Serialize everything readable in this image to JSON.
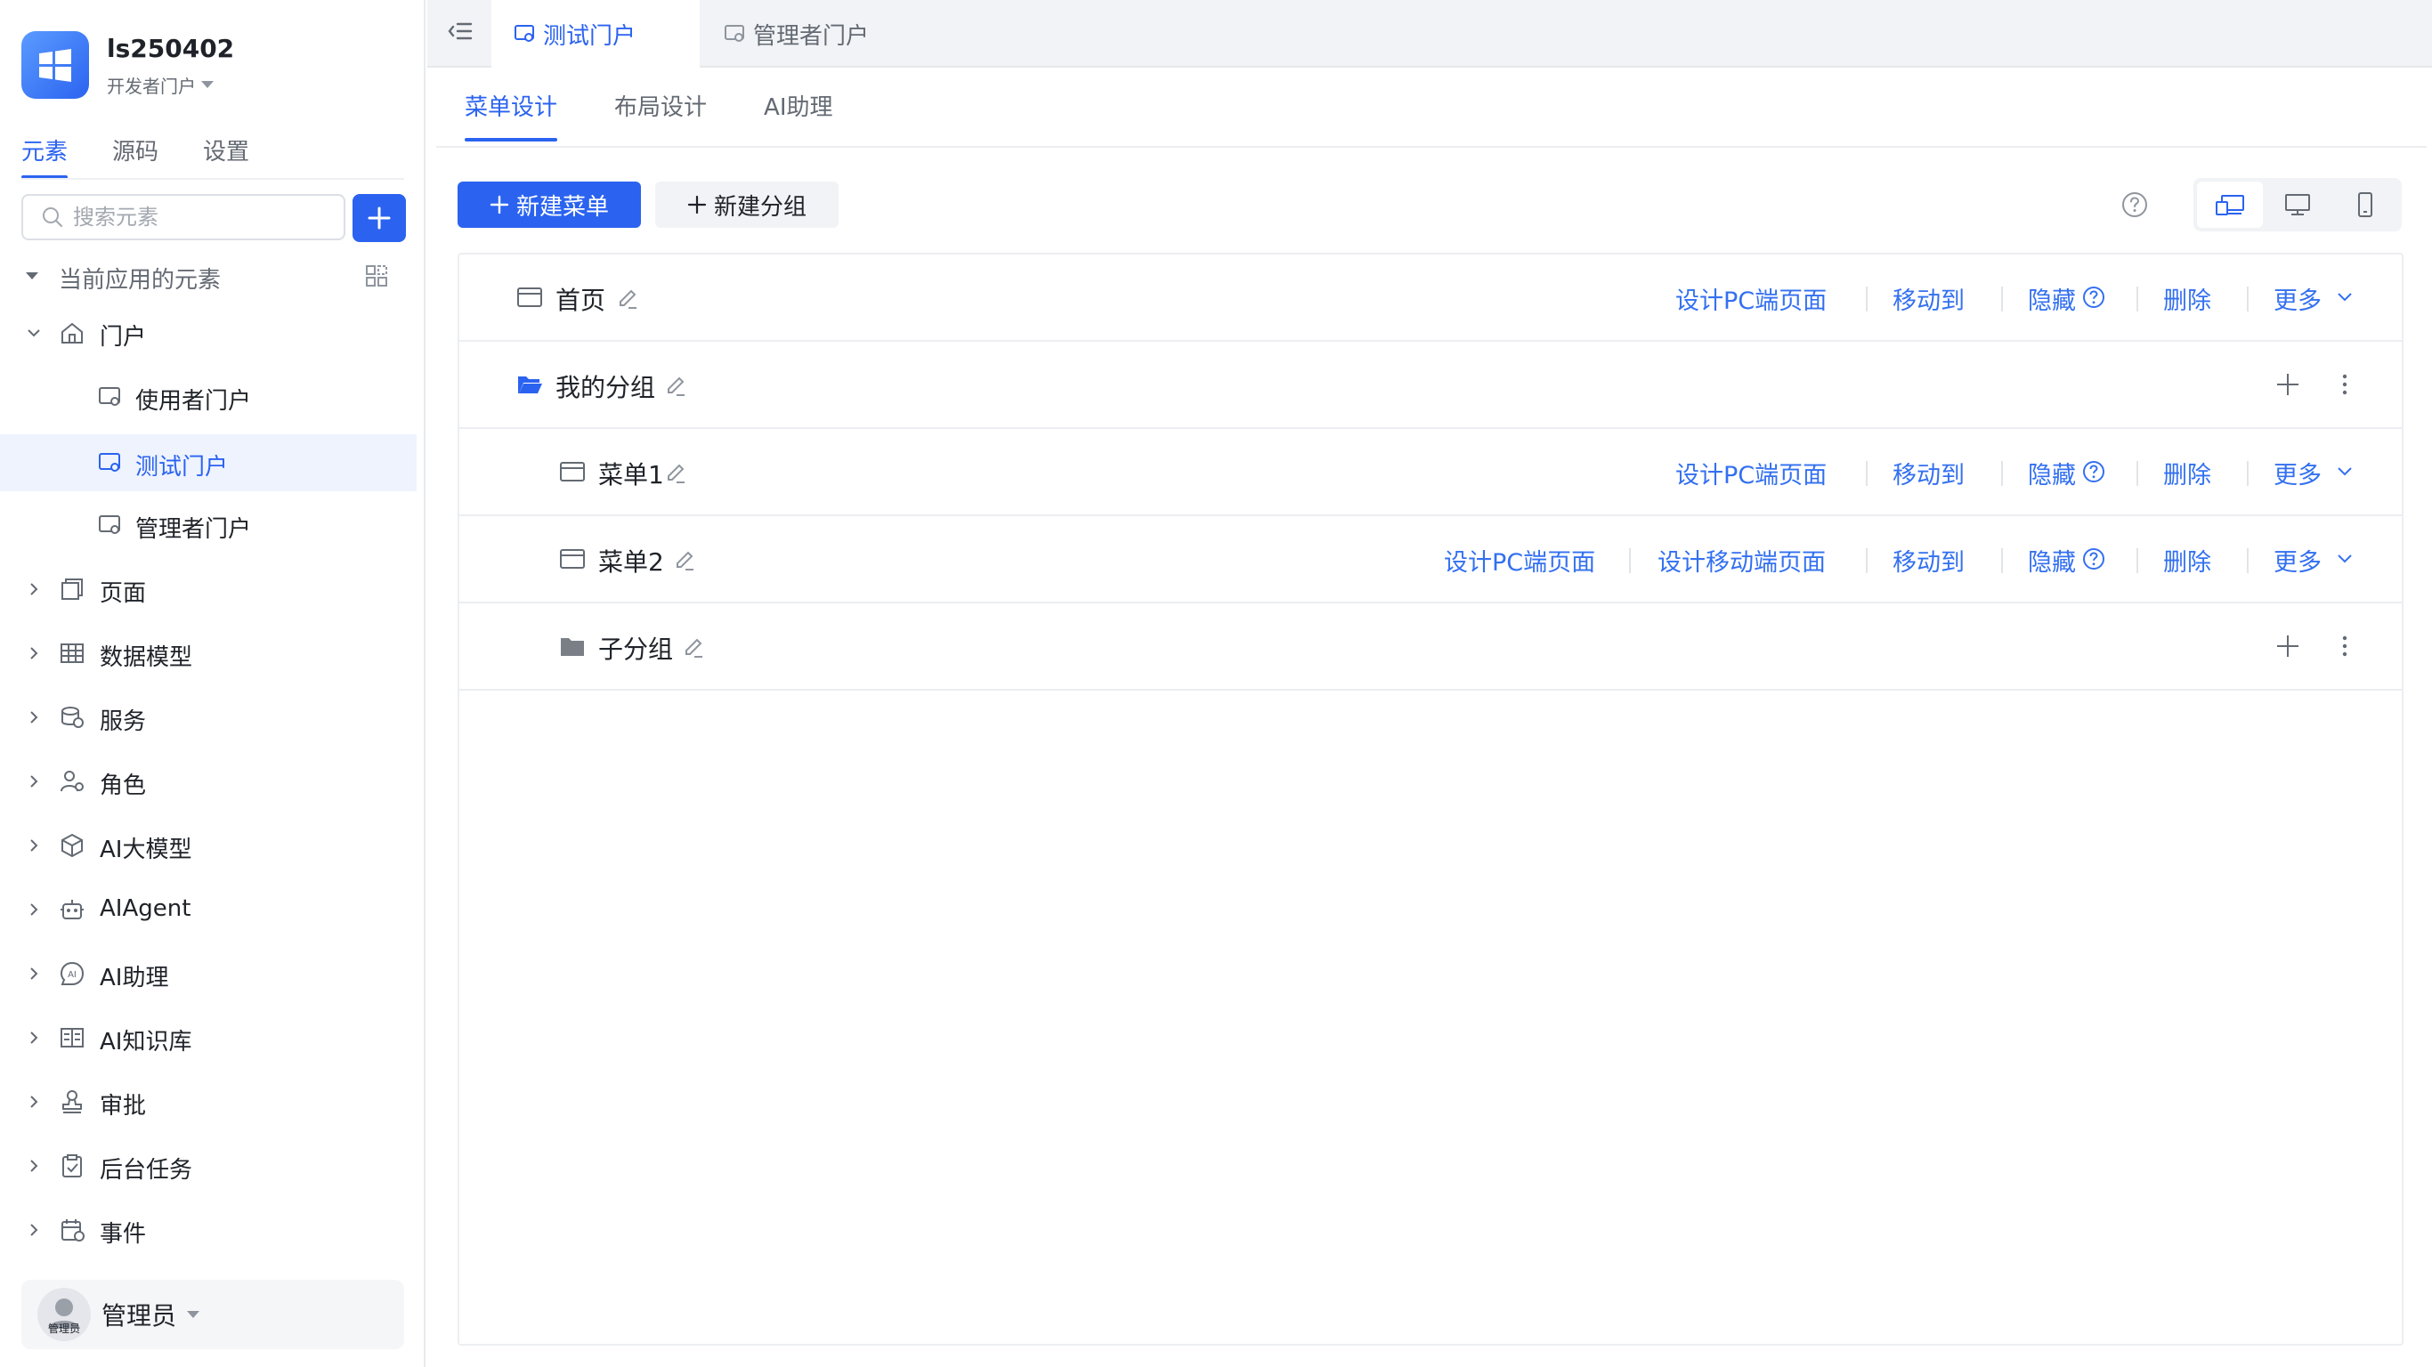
{
  "app": {
    "name": "ls250402",
    "portal": "开发者门户"
  },
  "sidebar": {
    "tabs": [
      "元素",
      "源码",
      "设置"
    ],
    "search_placeholder": "搜索元素",
    "section_title": "当前应用的元素",
    "tree": {
      "portal": "门户",
      "portal_children": [
        "使用者门户",
        "测试门户",
        "管理者门户"
      ],
      "items": [
        "页面",
        "数据模型",
        "服务",
        "角色",
        "AI大模型",
        "AIAgent",
        "AI助理",
        "AI知识库",
        "审批",
        "后台任务",
        "事件"
      ]
    },
    "user": {
      "name": "管理员",
      "avatar_tag": "管理员"
    }
  },
  "doc_tabs": [
    "测试门户",
    "管理者门户"
  ],
  "sub_tabs": [
    "菜单设计",
    "布局设计",
    "AI助理"
  ],
  "toolbar": {
    "new_menu": "新建菜单",
    "new_group": "新建分组"
  },
  "actions": {
    "design_pc": "设计PC端页面",
    "design_mobile": "设计移动端页面",
    "move_to": "移动到",
    "hide": "隐藏",
    "delete": "删除",
    "more": "更多"
  },
  "menu_rows": [
    {
      "label": "首页",
      "kind": "page"
    },
    {
      "label": "我的分组",
      "kind": "group"
    },
    {
      "label": "菜单1",
      "kind": "page"
    },
    {
      "label": "菜单2",
      "kind": "page"
    },
    {
      "label": "子分组",
      "kind": "group"
    }
  ],
  "colors": {
    "accent": "#2b63f0",
    "link": "#3370f0",
    "selected_bg": "#eef3fe"
  }
}
